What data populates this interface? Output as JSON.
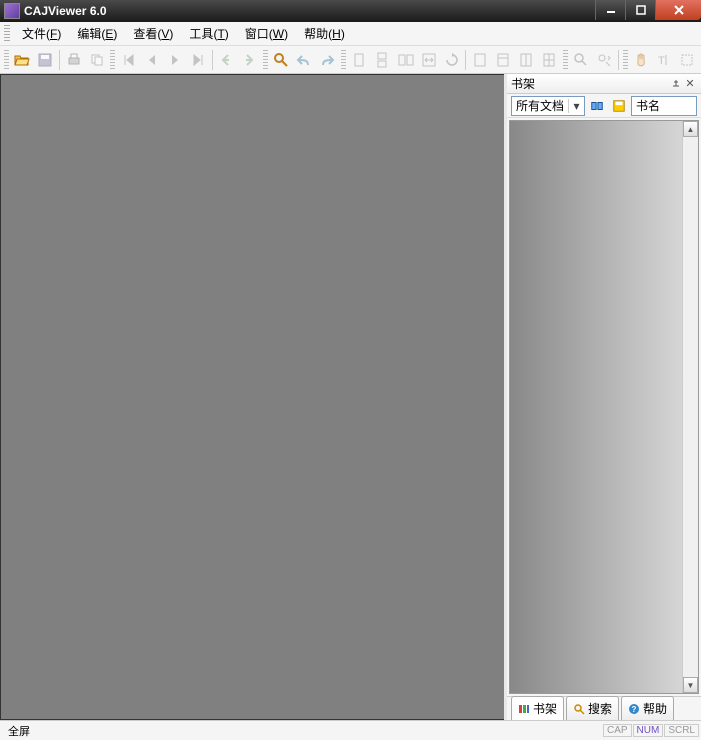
{
  "window": {
    "title": "CAJViewer 6.0"
  },
  "menu": {
    "file": {
      "label": "文件",
      "accel": "F"
    },
    "edit": {
      "label": "编辑",
      "accel": "E"
    },
    "view": {
      "label": "查看",
      "accel": "V"
    },
    "tools": {
      "label": "工具",
      "accel": "T"
    },
    "window": {
      "label": "窗口",
      "accel": "W"
    },
    "help": {
      "label": "帮助",
      "accel": "H"
    }
  },
  "side": {
    "title": "书架",
    "filter_selected": "所有文档",
    "column_label": "书名",
    "tabs": {
      "shelf": "书架",
      "search": "搜索",
      "help": "帮助"
    }
  },
  "status": {
    "left": "全屏",
    "cap": "CAP",
    "num": "NUM",
    "scrl": "SCRL"
  }
}
